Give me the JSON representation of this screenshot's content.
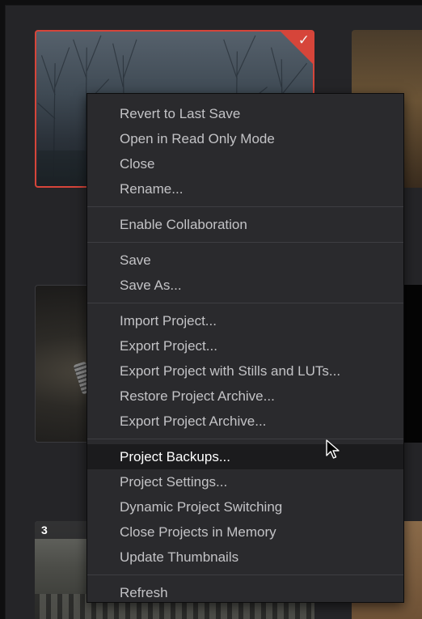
{
  "thumbnails": {
    "bottom_left_badge": "3"
  },
  "context_menu": {
    "groups": [
      [
        "Revert to Last Save",
        "Open in Read Only Mode",
        "Close",
        "Rename..."
      ],
      [
        "Enable Collaboration"
      ],
      [
        "Save",
        "Save As..."
      ],
      [
        "Import Project...",
        "Export Project...",
        "Export Project with Stills and LUTs...",
        "Restore Project Archive...",
        "Export Project Archive..."
      ],
      [
        "Project Backups...",
        "Project Settings...",
        "Dynamic Project Switching",
        "Close Projects in Memory",
        "Update Thumbnails"
      ],
      [
        "Refresh"
      ]
    ],
    "highlighted_item": "Project Backups..."
  },
  "colors": {
    "selection_accent": "#d6453a",
    "menu_background": "#2a2a2d",
    "menu_text": "#c3c3c6",
    "menu_highlight": "#1b1b1d"
  },
  "icons": {
    "selected_check": "checkmark-icon",
    "pointer": "mouse-cursor-icon"
  }
}
